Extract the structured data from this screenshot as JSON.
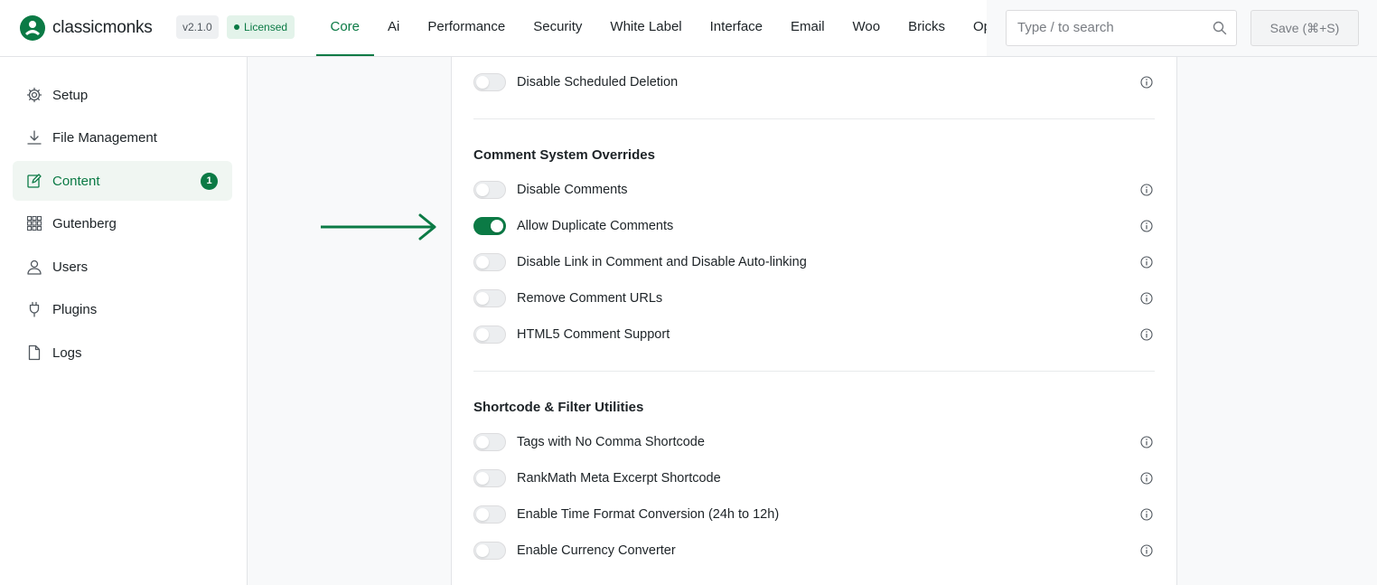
{
  "header": {
    "logo_text": "classicmonks",
    "version": "v2.1.0",
    "license": "Licensed",
    "tabs": [
      "Core",
      "Ai",
      "Performance",
      "Security",
      "White Label",
      "Interface",
      "Email",
      "Woo",
      "Bricks",
      "Opt"
    ],
    "active_tab": "Core",
    "search_placeholder": "Type / to search",
    "save_label": "Save (⌘+S)"
  },
  "sidebar": {
    "items": [
      {
        "label": "Setup",
        "icon": "gear-icon"
      },
      {
        "label": "File Management",
        "icon": "download-icon"
      },
      {
        "label": "Content",
        "icon": "edit-icon",
        "badge": "1",
        "active": true
      },
      {
        "label": "Gutenberg",
        "icon": "grid-icon"
      },
      {
        "label": "Users",
        "icon": "user-icon"
      },
      {
        "label": "Plugins",
        "icon": "plug-icon"
      },
      {
        "label": "Logs",
        "icon": "document-icon"
      }
    ]
  },
  "main": {
    "top_row": {
      "label": "Disable Scheduled Deletion",
      "enabled": false
    },
    "sections": [
      {
        "title": "Comment System Overrides",
        "rows": [
          {
            "label": "Disable Comments",
            "enabled": false
          },
          {
            "label": "Allow Duplicate Comments",
            "enabled": true
          },
          {
            "label": "Disable Link in Comment and Disable Auto-linking",
            "enabled": false
          },
          {
            "label": "Remove Comment URLs",
            "enabled": false
          },
          {
            "label": "HTML5 Comment Support",
            "enabled": false
          }
        ]
      },
      {
        "title": "Shortcode & Filter Utilities",
        "rows": [
          {
            "label": "Tags with No Comma Shortcode",
            "enabled": false
          },
          {
            "label": "RankMath Meta Excerpt Shortcode",
            "enabled": false
          },
          {
            "label": "Enable Time Format Conversion (24h to 12h)",
            "enabled": false
          },
          {
            "label": "Enable Currency Converter",
            "enabled": false
          }
        ]
      }
    ]
  },
  "colors": {
    "accent": "#0b7a45",
    "toggle_off": "#eceef0",
    "text": "#1d2327"
  }
}
